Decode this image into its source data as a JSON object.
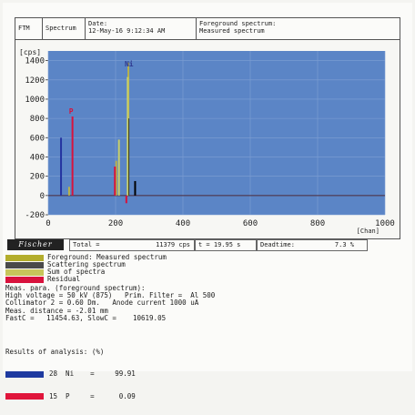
{
  "header": {
    "app": "FTM",
    "mode": "Spectrum",
    "date_label": "Date:",
    "date_value": "12-May-16 9:12:34 AM",
    "fg_label": "Foreground spectrum:",
    "fg_value": "Measured spectrum"
  },
  "chart_data": {
    "type": "line",
    "ylabel": "[cps]",
    "xlabel": "[Chan]",
    "xlim": [
      0,
      1000
    ],
    "ylim": [
      -200,
      1500
    ],
    "xticks": [
      "0",
      "200",
      "400",
      "600",
      "800",
      "1000"
    ],
    "yticks": [
      "1400",
      "1200",
      "1000",
      "800",
      "600",
      "400",
      "200",
      "0",
      "-200"
    ],
    "peak_labels": [
      {
        "text": "Ni",
        "x": 240,
        "y": 1340,
        "color": "#2f3a8f"
      },
      {
        "text": "P",
        "x": 68,
        "y": 850,
        "color": "#d8123c"
      }
    ],
    "plot_bg": "#5b85c6",
    "series": [
      {
        "name": "Foreground: Measured spectrum",
        "color": "#b9b24a",
        "peaks": [
          [
            62,
            90
          ],
          [
            202,
            360
          ],
          [
            238,
            1380
          ]
        ]
      },
      {
        "name": "Scattering spectrum",
        "color": "#000000",
        "peaks": [
          [
            238,
            800
          ],
          [
            258,
            150
          ]
        ]
      },
      {
        "name": "Sum of spectra",
        "color": "#c8cf6a",
        "peaks": [
          [
            210,
            580
          ],
          [
            236,
            1230
          ]
        ]
      },
      {
        "name": "Residual",
        "color": "#d8123c",
        "peaks": [
          [
            72,
            820
          ],
          [
            198,
            300
          ],
          [
            232,
            -80
          ]
        ]
      },
      {
        "name": "Element Ni",
        "color": "#2433a0",
        "peaks": [
          [
            38,
            600
          ]
        ]
      }
    ]
  },
  "status": {
    "brand": "Fischer",
    "total_label": "Total =",
    "total_value": "11379 cps",
    "time": "t = 19.95 s",
    "deadtime_label": "Deadtime:",
    "deadtime_value": "7.3 %"
  },
  "legend": [
    {
      "label": "Foreground: Measured spectrum",
      "color": "#b3ad2c"
    },
    {
      "label": "Scattering spectrum",
      "color": "#4a4a4a"
    },
    {
      "label": "Sum of spectra",
      "color": "#c7c55a"
    },
    {
      "label": "Residual",
      "color": "#d8123c"
    }
  ],
  "measurement": {
    "title": "Meas. para. (foreground spectrum):",
    "line1": "High voltage = 50 kV (875)   Prim. Filter =  Al 500",
    "line2": "Collimator 2 = 0.60 Dm.   Anode current 1000 uA",
    "line3": "Meas. distance = -2.01 mm",
    "line4": "FastC =   11454.63, SlowC =    10619.05"
  },
  "results": {
    "title": "Results of analysis: (%)",
    "rows": [
      {
        "text": "28  Ni    =     99.91",
        "color": "#1e3aa0"
      },
      {
        "text": "15  P     =      0.09",
        "color": "#e0153b"
      }
    ]
  }
}
